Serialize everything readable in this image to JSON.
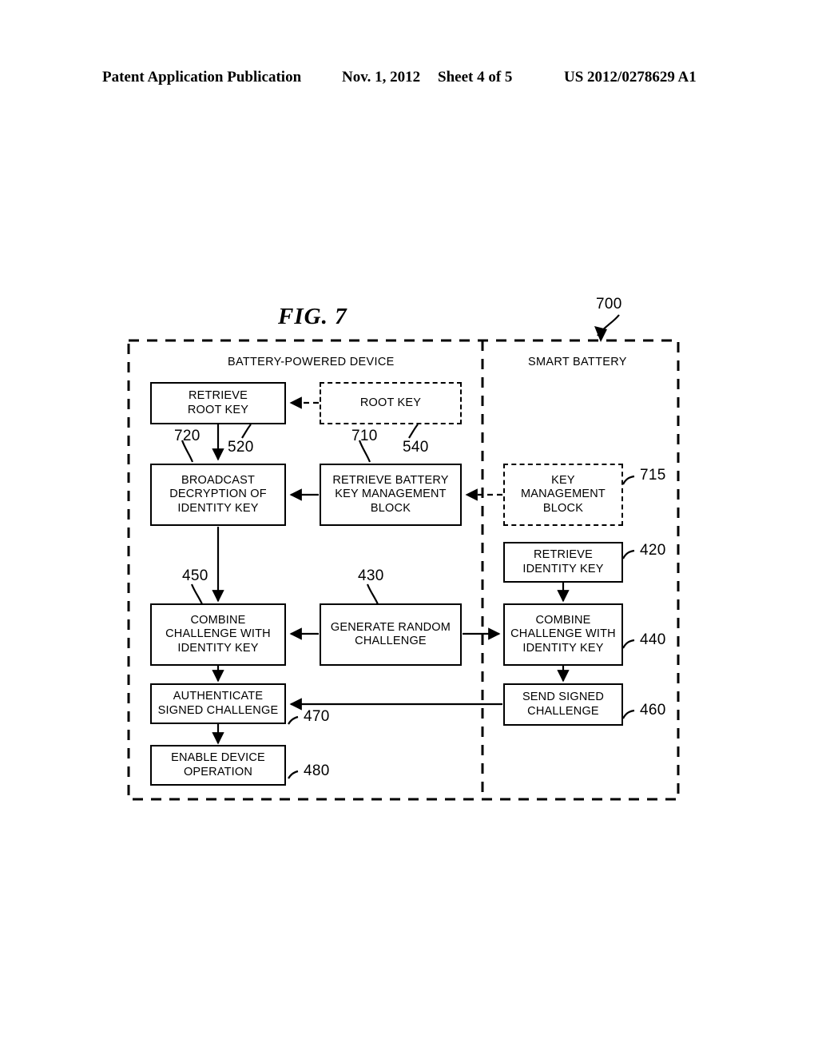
{
  "header": {
    "publication": "Patent Application Publication",
    "date": "Nov. 1, 2012",
    "sheet": "Sheet 4 of 5",
    "document_number": "US 2012/0278629 A1"
  },
  "figure": {
    "title": "FIG. 7",
    "system_ref": "700"
  },
  "lanes": [
    {
      "label": "BATTERY-POWERED DEVICE"
    },
    {
      "label": "SMART BATTERY"
    }
  ],
  "boxes": [
    {
      "id": "retrieve-root-key",
      "label": "RETRIEVE\nROOT KEY",
      "style": "solid",
      "ref": "520"
    },
    {
      "id": "root-key",
      "label": "ROOT KEY",
      "style": "dashed",
      "ref": "540"
    },
    {
      "id": "broadcast-decryption",
      "label": "BROADCAST\nDECRYPTION OF\nIDENTITY KEY",
      "style": "solid",
      "ref": "720"
    },
    {
      "id": "retrieve-battery-kmb",
      "label": "RETRIEVE BATTERY\nKEY MANAGEMENT\nBLOCK",
      "style": "solid",
      "ref": "710"
    },
    {
      "id": "key-management-block",
      "label": "KEY\nMANAGEMENT\nBLOCK",
      "style": "dashed",
      "ref": "715"
    },
    {
      "id": "retrieve-identity-key",
      "label": "RETRIEVE\nIDENTITY KEY",
      "style": "solid",
      "ref": "420"
    },
    {
      "id": "combine-device",
      "label": "COMBINE\nCHALLENGE WITH\nIDENTITY KEY",
      "style": "solid",
      "ref": "450"
    },
    {
      "id": "generate-random",
      "label": "GENERATE RANDOM\nCHALLENGE",
      "style": "solid",
      "ref": "430"
    },
    {
      "id": "combine-battery",
      "label": "COMBINE\nCHALLENGE WITH\nIDENTITY KEY",
      "style": "solid",
      "ref": "440"
    },
    {
      "id": "authenticate-challenge",
      "label": "AUTHENTICATE\nSIGNED CHALLENGE",
      "style": "solid",
      "ref": "470"
    },
    {
      "id": "send-signed-challenge",
      "label": "SEND SIGNED\nCHALLENGE",
      "style": "solid",
      "ref": "460"
    },
    {
      "id": "enable-device-operation",
      "label": "ENABLE DEVICE\nOPERATION",
      "style": "solid",
      "ref": "480"
    }
  ],
  "refs": {
    "system": "700",
    "retrieve_root_key": "520",
    "root_key": "540",
    "broadcast_decryption": "720",
    "retrieve_battery_kmb": "710",
    "key_management_block": "715",
    "retrieve_identity_key": "420",
    "combine_device": "450",
    "generate_random": "430",
    "combine_battery": "440",
    "authenticate_challenge": "470",
    "send_signed_challenge": "460",
    "enable_device_operation": "480"
  },
  "colors": {
    "ink": "#000000",
    "paper": "#ffffff"
  }
}
